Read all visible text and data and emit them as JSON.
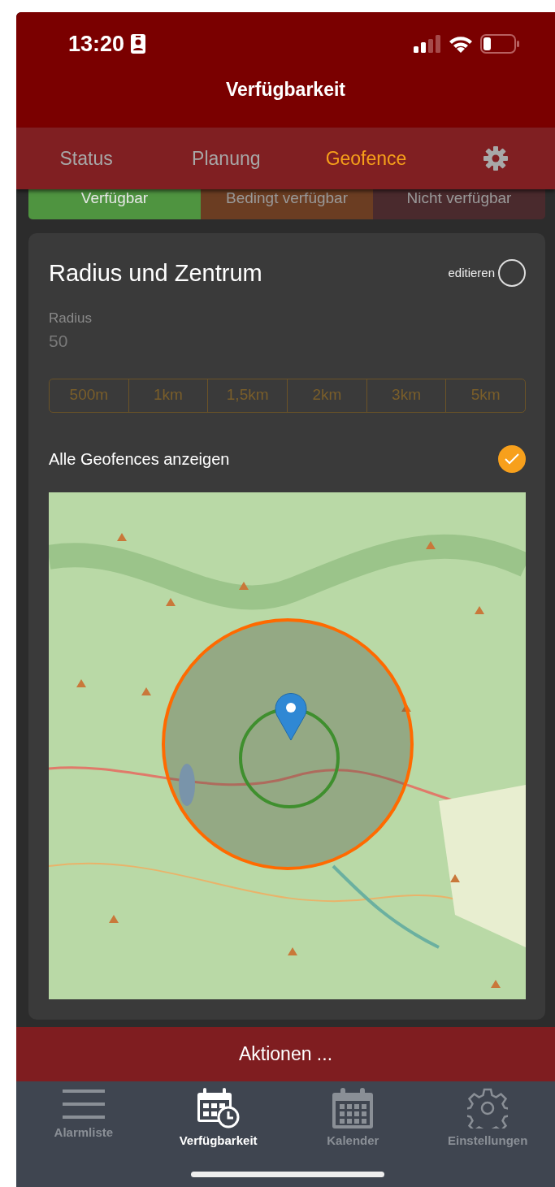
{
  "status_bar": {
    "time": "13:20"
  },
  "header": {
    "title": "Verfügbarkeit"
  },
  "tabs": [
    {
      "label": "Status",
      "selected": false
    },
    {
      "label": "Planung",
      "selected": false
    },
    {
      "label": "Geofence",
      "selected": true
    }
  ],
  "availability_segments": [
    {
      "label": "Verfügbar",
      "color": "#4f9440"
    },
    {
      "label": "Bedingt verfügbar",
      "color": "#6b3d22"
    },
    {
      "label": "Nicht verfügbar",
      "color": "#4a2a2d"
    }
  ],
  "card": {
    "title": "Radius und Zentrum",
    "edit_toggle": {
      "label": "editieren",
      "checked": false
    },
    "radius_field": {
      "label": "Radius",
      "value": "50",
      "disabled": true
    },
    "distance_options": {
      "disabled": true,
      "items": [
        "500m",
        "1km",
        "1,5km",
        "2km",
        "3km",
        "5km"
      ]
    },
    "show_all_geofences": {
      "label": "Alle Geofences anzeigen",
      "checked": true
    }
  },
  "actions_button": {
    "label": "Aktionen ..."
  },
  "bottom_nav": [
    {
      "label": "Alarmliste",
      "kind": "list",
      "selected": false
    },
    {
      "label": "Verfügbarkeit",
      "kind": "calendar-clock",
      "selected": true
    },
    {
      "label": "Kalender",
      "kind": "calendar",
      "selected": false
    },
    {
      "label": "Einstellungen",
      "kind": "gear",
      "selected": false
    }
  ]
}
